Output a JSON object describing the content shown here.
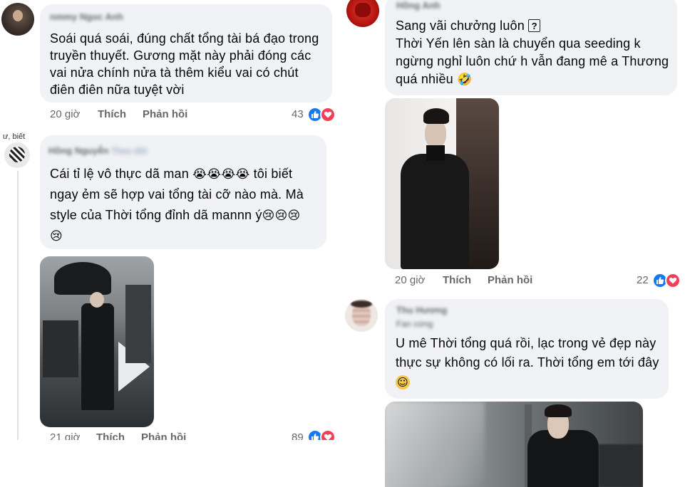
{
  "comments": [
    {
      "author": "nmmy Ngoc Anh",
      "text": "Soái quá soái, đúng chất tổng tài bá đạo trong\ntruyền thuyết. Gương mặt này phải đóng các\nvai nửa chính nửa tà thêm kiểu vai có chút\nđiên điên nữa tuyệt vời",
      "time": "20 giờ",
      "like": "Thích",
      "reply": "Phản hồi",
      "reactions": "43"
    },
    {
      "avatar_caption": "ư, biết",
      "author": "Hồng Nguyễn",
      "author_sub": "Theo dõi",
      "text_lines": [
        [
          "Cái tỉ lệ vô thực dã man ",
          "😭😭😭😭",
          " tôi biết"
        ],
        [
          "ngay ẻm sẽ hợp vai tổng tài cỡ nào mà. Mà"
        ],
        [
          "style của Thời tổng đỉnh dã mannn ý",
          "😢😢😢"
        ],
        [
          "",
          "😢"
        ]
      ],
      "time": "21 giờ",
      "like": "Thích",
      "reply": "Phản hồi",
      "reactions": "89"
    },
    {
      "author": "Hồng Anh",
      "text_lines": [
        [
          "Sang vãi chưởng luôn ",
          "?"
        ],
        [
          "Thời Yến lên sàn là chuyển qua seeding k"
        ],
        [
          "ngừng nghỉ luôn chứ h vẫn đang mê a Thương"
        ],
        [
          "quá nhiều ",
          "🤣"
        ]
      ],
      "time": "20 giờ",
      "like": "Thích",
      "reply": "Phản hồi",
      "reactions": "22"
    },
    {
      "author": "Thu Hương",
      "author_sub": "Fan cứng",
      "text_lines": [
        [
          "U mê Thời tổng quá rồi, lạc trong vẻ đẹp này"
        ],
        [
          "thực sự không có lối ra. Thời tổng em tới đây"
        ],
        [
          "",
          "☺"
        ]
      ]
    }
  ],
  "colors": {
    "bubble": "#f0f2f5",
    "meta": "#65676b",
    "like_blue": "#1877f2",
    "love_red": "#f33e58"
  },
  "icons": [
    "like-reaction-icon",
    "love-reaction-icon",
    "question-box-emoji"
  ]
}
